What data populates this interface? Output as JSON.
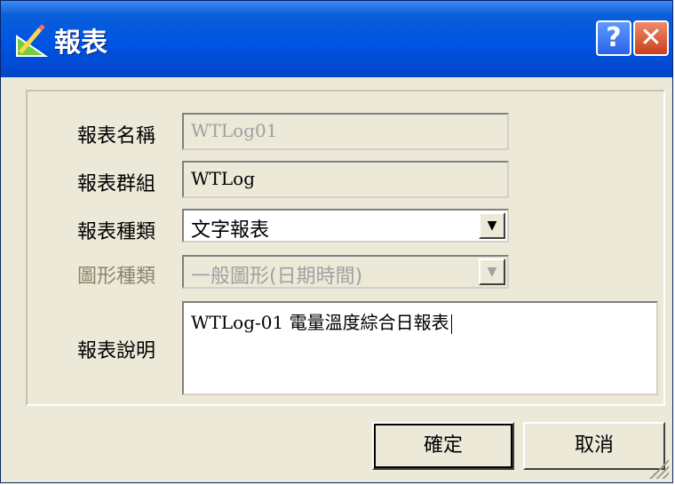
{
  "window": {
    "title": "報表",
    "title_icon": "pencil-ruler-icon",
    "help_glyph": "?",
    "close_glyph": "✕"
  },
  "form": {
    "name_label": "報表名稱",
    "name_value": "WTLog01",
    "group_label": "報表群組",
    "group_value": "WTLog",
    "type_label": "報表種類",
    "type_value": "文字報表",
    "graph_label": "圖形種類",
    "graph_value": "一般圖形(日期時間)",
    "desc_label": "報表說明",
    "desc_value": "WTLog-01 電量溫度綜合日報表"
  },
  "buttons": {
    "ok_label": "確定",
    "cancel_label": "取消"
  },
  "colors": {
    "titlebar": "#0054e3",
    "dialog_bg": "#ece9d8",
    "close_button": "#c8401c",
    "disabled_label": "#8a8469"
  }
}
